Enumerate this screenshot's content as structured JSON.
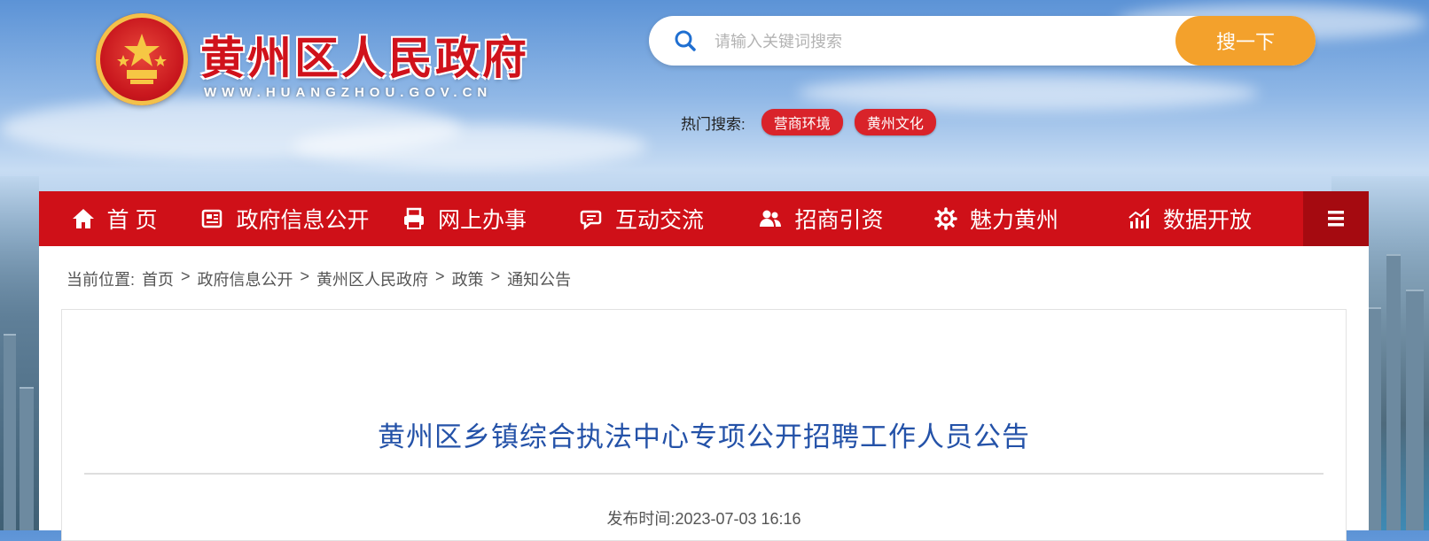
{
  "header": {
    "site_title": "黄州区人民政府",
    "site_url": "WWW.HUANGZHOU.GOV.CN"
  },
  "search": {
    "placeholder": "请输入关键词搜索",
    "button_label": "搜一下",
    "hot_label": "热门搜索:",
    "hot_tags": [
      "营商环境",
      "黄州文化"
    ]
  },
  "nav": {
    "items": [
      {
        "label": "首 页",
        "icon": "home-icon"
      },
      {
        "label": "政府信息公开",
        "icon": "newspaper-icon"
      },
      {
        "label": "网上办事",
        "icon": "printer-icon"
      },
      {
        "label": "互动交流",
        "icon": "chat-icon"
      },
      {
        "label": "招商引资",
        "icon": "users-icon"
      },
      {
        "label": "魅力黄州",
        "icon": "gear-icon"
      },
      {
        "label": "数据开放",
        "icon": "bar-chart-icon"
      }
    ],
    "menu_icon": "hamburger-menu-icon"
  },
  "breadcrumb": {
    "prefix": "当前位置:",
    "separator": ">",
    "items": [
      "首页",
      "政府信息公开",
      "黄州区人民政府",
      "政策",
      "通知公告"
    ]
  },
  "article": {
    "title": "黄州区乡镇综合执法中心专项公开招聘工作人员公告",
    "publish_info": "发布时间:2023-07-03 16:16"
  },
  "colors": {
    "nav_red": "#cf1018",
    "search_orange": "#f3a12c",
    "title_blue": "#2452a8",
    "hot_tag_red": "#d9232a"
  }
}
